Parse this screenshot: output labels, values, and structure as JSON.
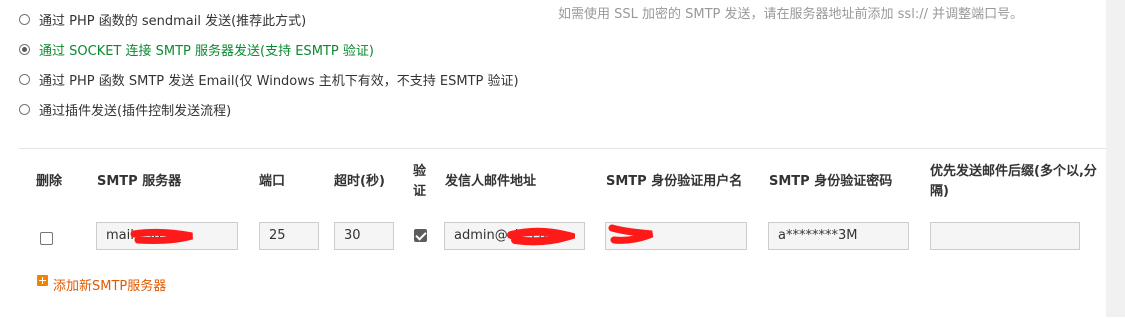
{
  "send_options": [
    {
      "label": "通过 PHP 函数的 sendmail 发送(推荐此方式)",
      "selected": false
    },
    {
      "label": "通过 SOCKET 连接 SMTP 服务器发送(支持 ESMTP 验证)",
      "selected": true
    },
    {
      "label": "通过 PHP 函数 SMTP 发送 Email(仅 Windows 主机下有效，不支持 ESMTP 验证)",
      "selected": false
    },
    {
      "label": "通过插件发送(插件控制发送流程)",
      "selected": false
    }
  ],
  "hint": "如需使用 SSL 加密的 SMTP 发送，请在服务器地址前添加 ssl:// 并调整端口号。",
  "table": {
    "headers": {
      "delete": "删除",
      "server": "SMTP 服务器",
      "port": "端口",
      "timeout": "超时(秒)",
      "auth": "验证",
      "from": "发信人邮件地址",
      "username": "SMTP 身份验证用户名",
      "password": "SMTP 身份验证密码",
      "suffix": "优先发送邮件后缀(多个以,分隔)"
    },
    "row": {
      "delete_checked": false,
      "server": "mail.c         in.cc",
      "port": "25",
      "timeout": "30",
      "auth_checked": true,
      "from": "admin@ch         .cu",
      "username": "",
      "password": "a********3M",
      "suffix": ""
    }
  },
  "add_server_label": "添加新SMTP服务器",
  "colors": {
    "selected_text": "#0a8a2e",
    "link": "#e05a00",
    "redaction": "#ff1a1a"
  }
}
